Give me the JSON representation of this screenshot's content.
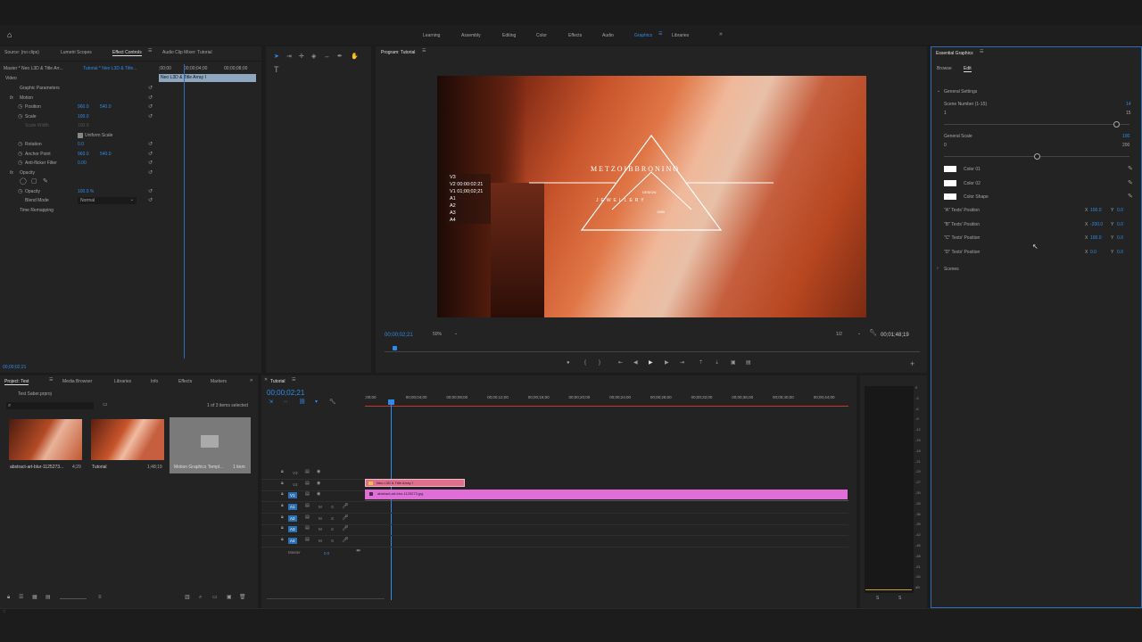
{
  "workspaces": {
    "items": [
      "Learning",
      "Assembly",
      "Editing",
      "Color",
      "Effects",
      "Audio",
      "Graphics",
      "Libraries"
    ],
    "active": "Graphics"
  },
  "source_panel": {
    "tabs": [
      "Source: (no clips)",
      "Lumetri Scopes",
      "Effect Controls",
      "Audio Clip Mixer: Tutorial"
    ],
    "master_label": "Master * Neo L3D & Title Arr...",
    "clip_label": "Tutorial * Neo L3D & Title...",
    "ruler": [
      ";00;00",
      "00;00;04;00",
      "00;00;08;00"
    ],
    "clip_bar": "Neo L3D & Title Array I",
    "video_label": "Video",
    "graphic_params": "Graphic Parameters",
    "motion": "Motion",
    "position_label": "Position",
    "position_x": "960.0",
    "position_y": "540.0",
    "scale_label": "Scale",
    "scale_val": "100.0",
    "scale_width_label": "Scale Width",
    "scale_width_val": "100.0",
    "uniform_scale": "Uniform Scale",
    "rotation_label": "Rotation",
    "rotation_val": "0.0",
    "anchor_label": "Anchor Point",
    "anchor_x": "960.0",
    "anchor_y": "540.0",
    "flicker_label": "Anti-flicker Filter",
    "flicker_val": "0.00",
    "opacity_section": "Opacity",
    "opacity_label": "Opacity",
    "opacity_val": "100.0 %",
    "blend_label": "Blend Mode",
    "blend_val": "Normal",
    "time_remap": "Time Remapping",
    "timecode": "00;00;02;21"
  },
  "program": {
    "title": "Program: Tutorial",
    "timecode": "00;00;02;21",
    "zoom": "50%",
    "quality": "1/2",
    "duration": "00;01;48;19",
    "overlay_title": "METZOIBBRONINO",
    "overlay_sub1": "DESIGN",
    "overlay_sub2": "JEWELLERY",
    "overlay_sub3": "1989",
    "track_overlay": [
      "V3",
      "V2 00:00:02:21",
      "V1 01;00;02;21",
      "A1",
      "A2",
      "A3",
      "A4"
    ]
  },
  "essential": {
    "title": "Essential Graphics",
    "tabs": [
      "Browse",
      "Edit"
    ],
    "active_tab": "Edit",
    "general_settings": "General Settings",
    "scene_label": "Scene Number (1-15)",
    "scene_val": "14",
    "scene_min": "1",
    "scene_max": "15",
    "scene_pos": 0.93,
    "scale_label": "General Scale",
    "scale_val": "100",
    "scale_min": "0",
    "scale_max": "200",
    "scale_pos": 0.5,
    "colors": [
      "Color 01",
      "Color 02",
      "Color Shape"
    ],
    "text_positions": [
      {
        "label": "\"A\" Texts' Position",
        "x": "100.0",
        "y": "0.0"
      },
      {
        "label": "\"B\" Texts' Position",
        "x": "-200.0",
        "y": "0.0"
      },
      {
        "label": "\"C\" Texts' Position",
        "x": "100.0",
        "y": "0.0"
      },
      {
        "label": "\"D\" Texts' Position",
        "x": "0.0",
        "y": "0.0"
      }
    ],
    "scenes": "Scenes",
    "x_label": "X",
    "y_label": "Y"
  },
  "project": {
    "tabs": [
      "Project: Test",
      "Media Browser",
      "Libraries",
      "Info",
      "Effects",
      "Markers"
    ],
    "file": "Test Saber.prproj",
    "count": "1 of 3 items selected",
    "items": [
      {
        "name": "abstract-art-blur-1125273...",
        "dur": "4;29"
      },
      {
        "name": "Tutorial",
        "dur": "1;48;19"
      },
      {
        "name": "Motion Graphics Templ...",
        "dur": "1 item"
      }
    ]
  },
  "timeline": {
    "title": "Tutorial",
    "timecode": "00;00;02;21",
    "ruler": [
      ";00;00",
      "00;00;04;00",
      "00;00;08;00",
      "00;00;12;00",
      "00;00;16;00",
      "00;00;20;00",
      "00;00;24;00",
      "00;00;28;00",
      "00;00;32;00",
      "00;00;36;00",
      "00;00;40;00",
      "00;00;44;00"
    ],
    "video_tracks": [
      "V3",
      "V2",
      "V1"
    ],
    "audio_tracks": [
      "A1",
      "A2",
      "A3",
      "A4"
    ],
    "master": "Master",
    "master_val": "0.0",
    "clip_v2": "Neo L3D & Title Array I",
    "clip_v1": "abstract-art-blur-1125273.jpg",
    "ms": [
      "M",
      "S"
    ]
  },
  "meter": {
    "ticks": [
      "0",
      "-3",
      "-6",
      "-9",
      "-12",
      "-15",
      "-18",
      "-21",
      "-24",
      "-27",
      "-30",
      "-33",
      "-36",
      "-39",
      "-42",
      "-45",
      "-48",
      "-51",
      "-54",
      "dB"
    ],
    "bottom": [
      "S",
      "S"
    ]
  }
}
